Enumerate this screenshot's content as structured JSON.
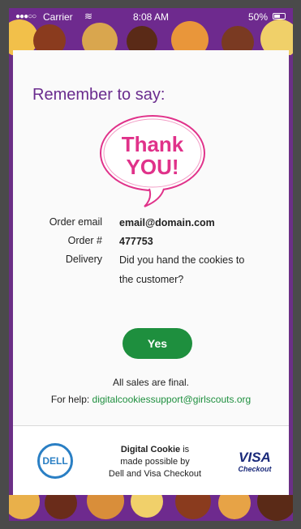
{
  "status_bar": {
    "carrier": "Carrier",
    "time": "8:08 AM",
    "battery": "50%"
  },
  "heading": "Remember to say:",
  "bubble": {
    "line1": "Thank",
    "line2": "YOU!"
  },
  "order": {
    "email_label": "Order email",
    "email_value": "email@domain.com",
    "number_label": "Order #",
    "number_value": "477753",
    "delivery_label": "Delivery",
    "delivery_line1": "Did you hand the cookies to",
    "delivery_line2": "the customer?"
  },
  "yes_button": "Yes",
  "final_text": "All sales are final.",
  "help": {
    "prefix": "For help:",
    "email": "digitalcookiessupport@girlscouts.org"
  },
  "footer": {
    "dell_logo": "DELL",
    "brand": "Digital Cookie",
    "line1_suffix": " is",
    "line2": "made possible by",
    "line3": "Dell and Visa Checkout",
    "visa": "VISA",
    "visa_checkout": "Checkout"
  },
  "colors": {
    "purple": "#6a2c8e",
    "green": "#1e8f3e",
    "pink": "#e0328a",
    "dell_blue": "#2a7fc4",
    "visa_navy": "#1a2a7a"
  }
}
